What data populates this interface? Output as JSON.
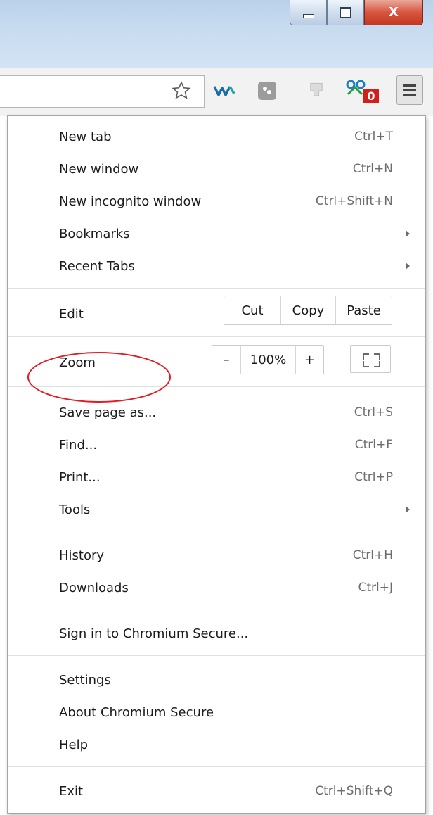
{
  "window_controls": {
    "minimize_icon": "minimize-icon",
    "maximize_icon": "maximize-icon",
    "close_glyph": "X"
  },
  "toolbar": {
    "icons": [
      "star-bookmark-icon",
      "extension-w-icon",
      "extension-app-icon",
      "download-arrow-icon",
      "extension-badge-icon",
      "hamburger-menu-icon"
    ],
    "badge_count": "0"
  },
  "menu": {
    "new_tab": {
      "label": "New tab",
      "accel": "Ctrl+T"
    },
    "new_window": {
      "label": "New window",
      "accel": "Ctrl+N"
    },
    "new_incognito": {
      "label": "New incognito window",
      "accel": "Ctrl+Shift+N"
    },
    "bookmarks": {
      "label": "Bookmarks"
    },
    "recent_tabs": {
      "label": "Recent Tabs"
    },
    "edit": {
      "label": "Edit",
      "cut": "Cut",
      "copy": "Copy",
      "paste": "Paste"
    },
    "zoom": {
      "label": "Zoom",
      "minus": "–",
      "level": "100%",
      "plus": "+"
    },
    "save_page": {
      "label": "Save page as...",
      "accel": "Ctrl+S"
    },
    "find": {
      "label": "Find...",
      "accel": "Ctrl+F"
    },
    "print": {
      "label": "Print...",
      "accel": "Ctrl+P"
    },
    "tools": {
      "label": "Tools"
    },
    "history": {
      "label": "History",
      "accel": "Ctrl+H"
    },
    "downloads": {
      "label": "Downloads",
      "accel": "Ctrl+J"
    },
    "sign_in": {
      "label": "Sign in to Chromium Secure..."
    },
    "settings": {
      "label": "Settings"
    },
    "about": {
      "label": "About Chromium Secure"
    },
    "help": {
      "label": "Help"
    },
    "exit": {
      "label": "Exit",
      "accel": "Ctrl+Shift+Q"
    }
  },
  "colors": {
    "annotation": "#e01b22",
    "close_button": "#d8553f",
    "badge": "#d0201a"
  }
}
